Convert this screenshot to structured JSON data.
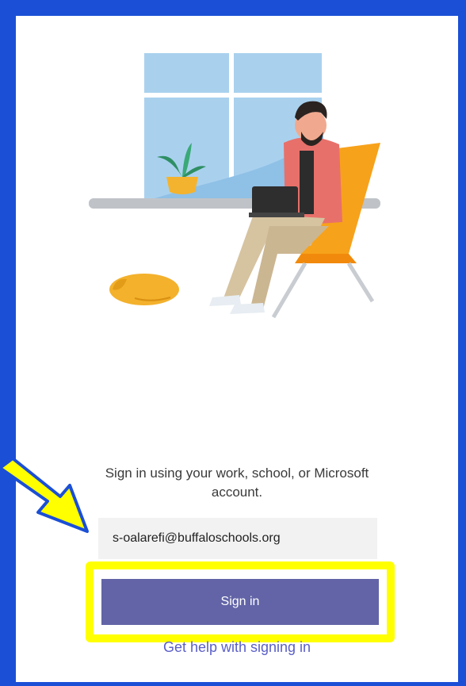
{
  "prompt_text": "Sign in using your work, school, or Microsoft account.",
  "email_value": "s-oalarefi@buffaloschools.org",
  "signin_label": "Sign in",
  "help_link": "Get help with signing in",
  "colors": {
    "frame": "#1b4fd6",
    "button": "#6264a7",
    "link": "#5b5fc7",
    "highlight": "#ffff00"
  }
}
